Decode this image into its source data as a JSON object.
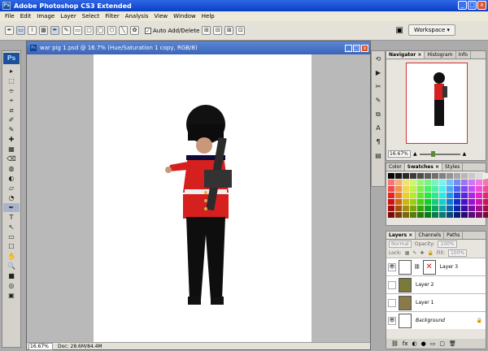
{
  "app": {
    "title": "Adobe Photoshop CS3 Extended",
    "icon": "Ps",
    "win_min": "_",
    "win_max": "□",
    "win_close": "x"
  },
  "menu": [
    "File",
    "Edit",
    "Image",
    "Layer",
    "Select",
    "Filter",
    "Analysis",
    "View",
    "Window",
    "Help"
  ],
  "options": {
    "auto_add_delete": "Auto Add/Delete",
    "workspace": "Workspace ▾",
    "checkmark": "✓"
  },
  "tools": [
    "▸",
    "⬚",
    "⌯",
    "⌖",
    "⧄",
    "✐",
    "✎",
    "✚",
    "▦",
    "⌫",
    "◍",
    "◐",
    "▱",
    "◔",
    "✒",
    "T",
    "↖",
    "▭",
    "☐",
    "✋",
    "🔍",
    "■",
    "◎",
    "▣"
  ],
  "document": {
    "title": "war pig 1.psd @ 16.7% (Hue/Saturation 1 copy, RGB/8)",
    "icon": "Ps",
    "zoom": "16.67%",
    "doc_size": "Doc: 28.6M/84.4M"
  },
  "navigator": {
    "tabs": [
      "Navigator ×",
      "Histogram",
      "Info"
    ],
    "zoom": "16.67%"
  },
  "swatches": {
    "tabs": [
      "Color",
      "Swatches ×",
      "Styles"
    ]
  },
  "layers": {
    "tabs": [
      "Layers ×",
      "Channels",
      "Paths"
    ],
    "blend_mode": "Normal",
    "opacity_label": "Opacity:",
    "opacity": "100%",
    "lock_label": "Lock:",
    "fill_label": "Fill:",
    "fill": "100%",
    "items": [
      {
        "name": "Layer 3",
        "eye": "👁"
      },
      {
        "name": "Layer 2",
        "eye": ""
      },
      {
        "name": "Layer 1",
        "eye": ""
      },
      {
        "name": "Background",
        "eye": "👁",
        "lock": "🔒"
      }
    ],
    "bottom_icons": [
      "⛓",
      "fx",
      "◐",
      "●",
      "▭",
      "▢",
      "🗑"
    ]
  },
  "colors": {
    "title_blue": "#0a3fc2",
    "soldier_red": "#d61f1f",
    "nav_box": "#d03030"
  }
}
